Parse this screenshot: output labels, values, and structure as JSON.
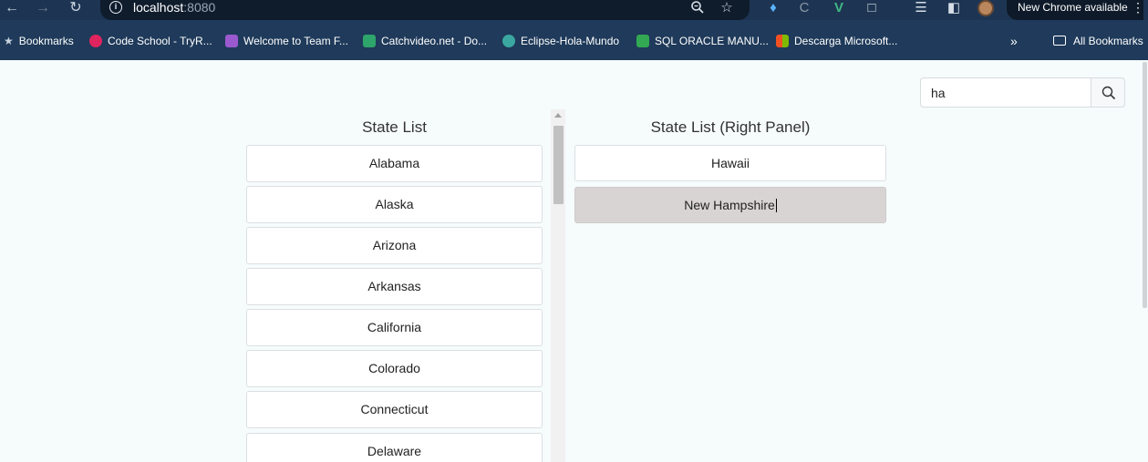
{
  "browser": {
    "url_host": "localhost",
    "url_port": ":8080",
    "update_label": "New Chrome available",
    "bookmarks": [
      {
        "label": "Bookmarks",
        "icon": "star-icon",
        "color": "#c9d3df"
      },
      {
        "label": "Code School - TryR...",
        "icon": "codeschool-icon",
        "color": "#e0245e"
      },
      {
        "label": "Welcome to Team F...",
        "icon": "visualstudio-icon",
        "color": "#9b59d0"
      },
      {
        "label": "Catchvideo.net - Do...",
        "icon": "catchvideo-icon",
        "color": "#2ea56b"
      },
      {
        "label": "Eclipse-Hola-Mundo",
        "icon": "eclipse-icon",
        "color": "#3aa8a0"
      },
      {
        "label": "SQL ORACLE MANU...",
        "icon": "doc-icon",
        "color": "#33a852"
      },
      {
        "label": "Descarga Microsoft...",
        "icon": "microsoft-icon",
        "color": "#f25022"
      }
    ],
    "all_bookmarks_label": "All Bookmarks"
  },
  "search": {
    "value": "ha"
  },
  "left_panel": {
    "title": "State List",
    "items": [
      "Alabama",
      "Alaska",
      "Arizona",
      "Arkansas",
      "California",
      "Colorado",
      "Connecticut",
      "Delaware"
    ]
  },
  "right_panel": {
    "title": "State List (Right Panel)",
    "items": [
      "Hawaii",
      "New Hampshire"
    ],
    "active_index": 1
  },
  "colors": {
    "chrome_bg": "#1f3a5a",
    "page_bg": "#f6fbfb",
    "active_item_bg": "#d9d4d4"
  }
}
